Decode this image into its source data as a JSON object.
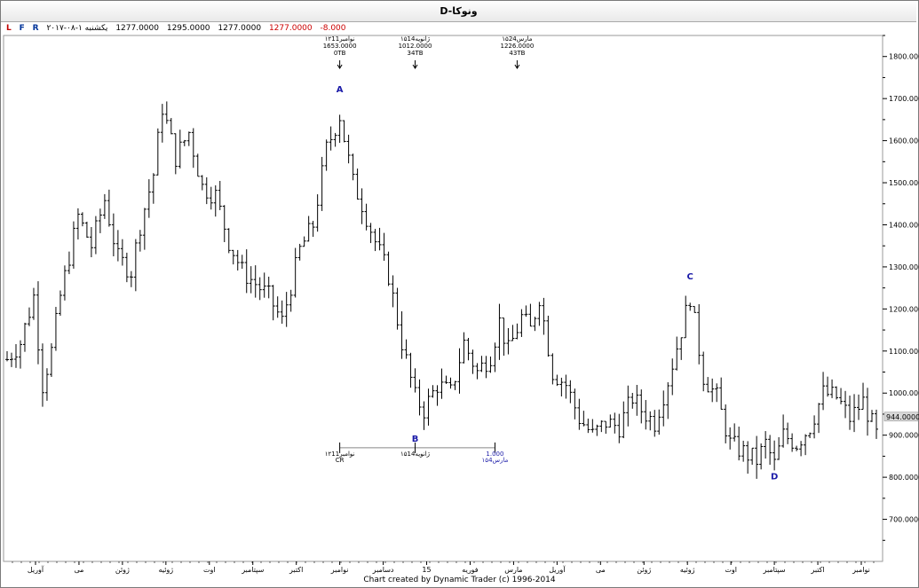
{
  "title": "D-ونوکا",
  "info": {
    "day": "۲۰۱۷-۰۸-۱ یکشنبه",
    "open": "1277.0000",
    "high": "1295.0000",
    "low": "1277.0000",
    "close": "1277.0000",
    "change": "-8.000"
  },
  "flags": [
    "L",
    "F",
    "R"
  ],
  "colors": {
    "bars": "#000000",
    "wave_labels": "#1a1aa8",
    "grid": "#e6e6e6",
    "last_price_bg": "#d9d9d9"
  },
  "chart_data": {
    "type": "bar",
    "style": "ohlc",
    "ylim": [
      600,
      1850
    ],
    "y_ticks": [
      700,
      800,
      900,
      1000,
      1100,
      1200,
      1300,
      1400,
      1500,
      1600,
      1700,
      1800
    ],
    "y_tick_labels": [
      "700.0000",
      "800.0000",
      "900.0000",
      "1000.0000",
      "1100.0000",
      "1200.0000",
      "1300.0000",
      "1400.0000",
      "1500.0000",
      "1600.0000",
      "1700.0000",
      "1800.0000"
    ],
    "x_month_labels": [
      "آوریل",
      "می",
      "ژوئن",
      "ژوئیه",
      "اوت",
      "سپتامبر",
      "اکتبر",
      "نوامبر",
      "دسامبر",
      "15",
      "فوریه",
      "مارس",
      "آوریل",
      "می",
      "ژوئن",
      "ژوئیه",
      "اوت",
      "سپتامبر",
      "اکتبر",
      "نوامبر"
    ],
    "last_price": 944,
    "last_price_label": "944.0000",
    "path": [
      [
        0,
        1080
      ],
      [
        3,
        1120
      ],
      [
        6,
        1230
      ],
      [
        8,
        1020
      ],
      [
        10,
        1100
      ],
      [
        12,
        1230
      ],
      [
        16,
        1420
      ],
      [
        19,
        1350
      ],
      [
        22,
        1460
      ],
      [
        25,
        1320
      ],
      [
        28,
        1290
      ],
      [
        30,
        1400
      ],
      [
        33,
        1520
      ],
      [
        35,
        1680
      ],
      [
        38,
        1560
      ],
      [
        41,
        1620
      ],
      [
        44,
        1490
      ],
      [
        47,
        1470
      ],
      [
        50,
        1360
      ],
      [
        53,
        1290
      ],
      [
        56,
        1260
      ],
      [
        59,
        1230
      ],
      [
        62,
        1170
      ],
      [
        66,
        1340
      ],
      [
        69,
        1400
      ],
      [
        72,
        1580
      ],
      [
        75,
        1660
      ],
      [
        78,
        1500
      ],
      [
        80,
        1450
      ],
      [
        83,
        1360
      ],
      [
        86,
        1280
      ],
      [
        89,
        1120
      ],
      [
        92,
        990
      ],
      [
        94,
        960
      ],
      [
        97,
        1020
      ],
      [
        100,
        1000
      ],
      [
        103,
        1120
      ],
      [
        106,
        1050
      ],
      [
        109,
        1090
      ],
      [
        111,
        1170
      ],
      [
        113,
        1100
      ],
      [
        116,
        1180
      ],
      [
        118,
        1150
      ],
      [
        120,
        1230
      ],
      [
        123,
        1050
      ],
      [
        126,
        1020
      ],
      [
        129,
        940
      ],
      [
        132,
        900
      ],
      [
        135,
        930
      ],
      [
        138,
        920
      ],
      [
        141,
        990
      ],
      [
        143,
        960
      ],
      [
        146,
        930
      ],
      [
        149,
        1030
      ],
      [
        152,
        1150
      ],
      [
        154,
        1230
      ],
      [
        157,
        1040
      ],
      [
        160,
        990
      ],
      [
        163,
        880
      ],
      [
        166,
        860
      ],
      [
        169,
        840
      ],
      [
        171,
        880
      ],
      [
        173,
        830
      ],
      [
        175,
        900
      ],
      [
        178,
        880
      ],
      [
        181,
        920
      ],
      [
        184,
        1000
      ],
      [
        187,
        990
      ],
      [
        190,
        940
      ],
      [
        193,
        980
      ],
      [
        196,
        900
      ]
    ],
    "wave_labels": [
      {
        "label": "A",
        "x": 75,
        "y": 1715
      },
      {
        "label": "B",
        "x": 92,
        "y": 885
      },
      {
        "label": "C",
        "x": 154,
        "y": 1270
      },
      {
        "label": "D",
        "x": 173,
        "y": 795
      }
    ],
    "top_annotations": [
      {
        "x": 75,
        "lines": [
          "۱۲نوامبر11",
          "1653.0000",
          "0TB"
        ]
      },
      {
        "x": 92,
        "lines": [
          "۱۵ژانویه14",
          "1012.0000",
          "34TB"
        ]
      },
      {
        "x": 115,
        "lines": [
          "۱۵مارس24",
          "1226.0000",
          "43TB"
        ]
      }
    ],
    "time_ruler": {
      "y": 870,
      "start_x": 75,
      "mid_x": 92,
      "end_x": 110,
      "start_label": "۱۲نوامبر11",
      "start_sub": "CR",
      "mid_label": "۱۵ژانویه14",
      "end_label": "1.000",
      "end_sub": "۱۵مارس4"
    }
  },
  "footer": "Chart created by Dynamic Trader  (c) 1996-2014"
}
